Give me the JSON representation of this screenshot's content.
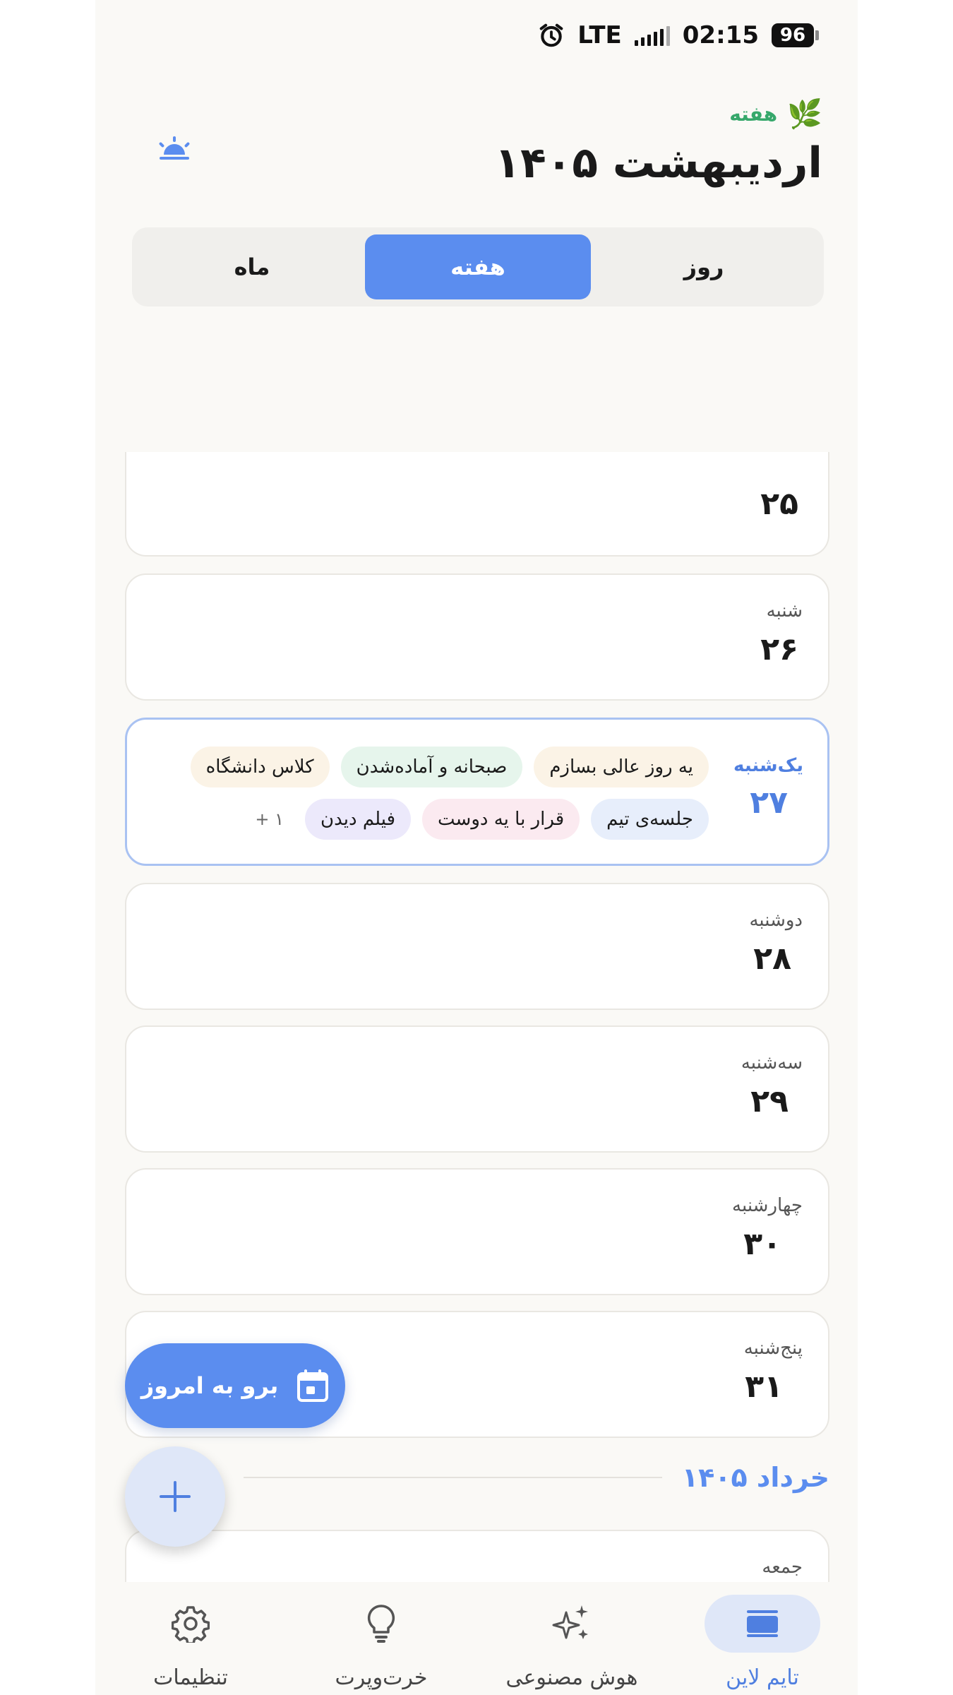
{
  "status_bar": {
    "network": "LTE",
    "time": "02:15",
    "battery": "96"
  },
  "header": {
    "week_label": "هفته",
    "title": "اردیبهشت ۱۴۰۵"
  },
  "segmented": {
    "day": "روز",
    "week": "هفته",
    "month": "ماه",
    "selected": "week"
  },
  "days": [
    {
      "weekday": "",
      "date": "۲۵",
      "partial": true
    },
    {
      "weekday": "شنبه",
      "date": "۲۶"
    },
    {
      "weekday": "یک‌شنبه",
      "date": "۲۷",
      "today": true,
      "events": [
        {
          "title": "یه روز عالی بسازم",
          "color": "#fbf3e6"
        },
        {
          "title": "صبحانه و آماده‌شدن",
          "color": "#e6f5ec"
        },
        {
          "title": "کلاس دانشگاه",
          "color": "#fbf3e6"
        },
        {
          "title": "جلسه‌ی تیم",
          "color": "#e7eefb"
        },
        {
          "title": "قرار با یه دوست",
          "color": "#fbeaf0"
        },
        {
          "title": "فیلم دیدن",
          "color": "#ece9fb"
        }
      ],
      "more": "+ ۱"
    },
    {
      "weekday": "دوشنبه",
      "date": "۲۸"
    },
    {
      "weekday": "سه‌شنبه",
      "date": "۲۹"
    },
    {
      "weekday": "چهارشنبه",
      "date": "۳۰"
    },
    {
      "weekday": "پنج‌شنبه",
      "date": "۳۱"
    }
  ],
  "next_month": {
    "label": "خرداد ۱۴۰۵",
    "first_weekday": "جمعه"
  },
  "today_button": {
    "label": "برو به امروز"
  },
  "bottom_nav": [
    {
      "label": "تایم لاین",
      "icon": "timeline-icon",
      "active": true
    },
    {
      "label": "هوش مصنوعی",
      "icon": "sparkle-icon",
      "active": false
    },
    {
      "label": "خرت‌وپرت",
      "icon": "lightbulb-icon",
      "active": false
    },
    {
      "label": "تنظیمات",
      "icon": "gear-icon",
      "active": false
    }
  ],
  "colors": {
    "accent": "#5b8def",
    "accent_text": "#4f7fe0",
    "green": "#36a86b"
  }
}
